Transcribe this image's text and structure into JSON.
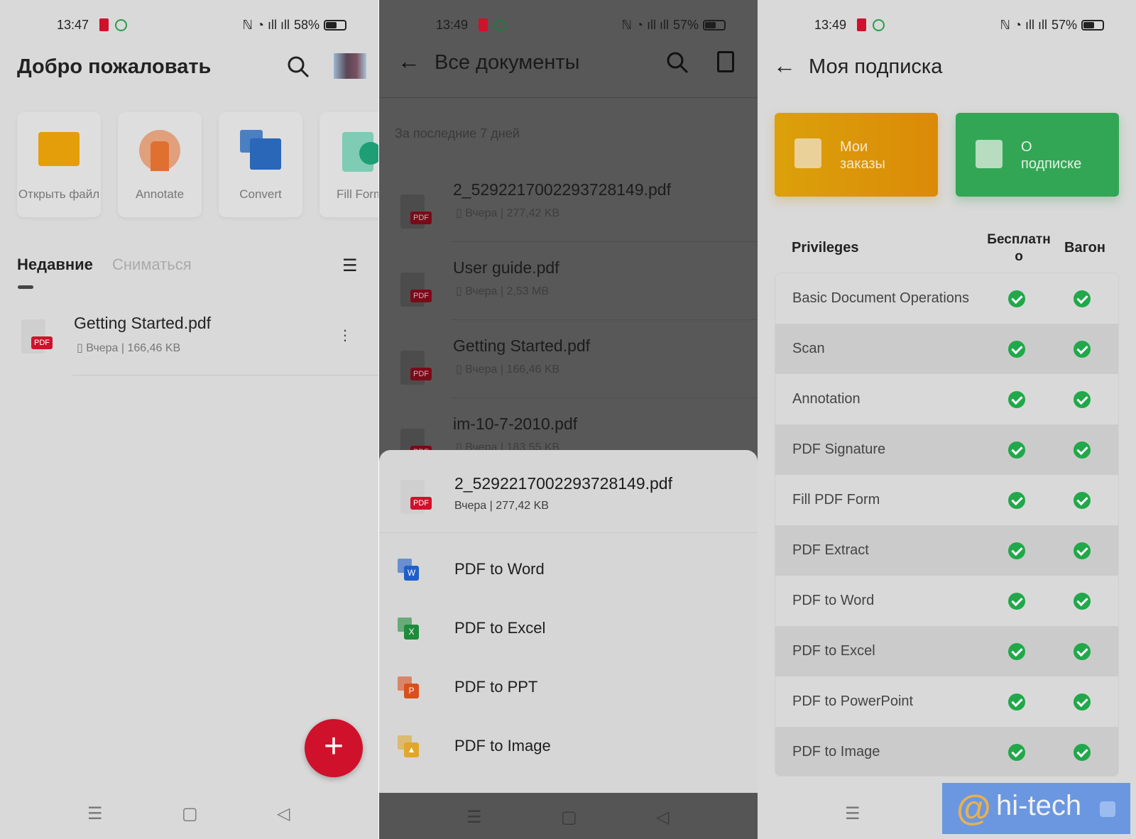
{
  "screen1": {
    "status": {
      "time": "13:47",
      "battery": "58%",
      "battery_level": 58
    },
    "title": "Добро пожаловать",
    "tools": [
      {
        "label": "Открыть файл",
        "icon": "folder-icon"
      },
      {
        "label": "Annotate",
        "icon": "highlighter-icon"
      },
      {
        "label": "Convert",
        "icon": "convert-icon"
      },
      {
        "label": "Fill Form",
        "icon": "clipboard-check-icon"
      }
    ],
    "tabs": [
      {
        "label": "Недавние",
        "active": true
      },
      {
        "label": "Сниматься",
        "active": false
      }
    ],
    "files": [
      {
        "name": "Getting Started.pdf",
        "meta": "Вчера | 166,46 KB",
        "badge": "PDF"
      }
    ],
    "fab": "+"
  },
  "screen2": {
    "status": {
      "time": "13:49",
      "battery": "57%",
      "battery_level": 57
    },
    "title": "Все документы",
    "section": "За последние 7 дней",
    "files": [
      {
        "name": "2_5292217002293728149.pdf",
        "meta": "Вчера | 277,42 KB",
        "badge": "PDF"
      },
      {
        "name": "User guide.pdf",
        "meta": "Вчера | 2,53 MB",
        "badge": "PDF"
      },
      {
        "name": "Getting Started.pdf",
        "meta": "Вчера | 166,46 KB",
        "badge": "PDF"
      },
      {
        "name": "im-10-7-2010.pdf",
        "meta": "Вчера | 183,55 KB",
        "badge": "PDF"
      }
    ],
    "sheet": {
      "file": {
        "name": "2_5292217002293728149.pdf",
        "meta": "Вчера | 277,42 KB",
        "badge": "PDF"
      },
      "actions": [
        {
          "label": "PDF to Word",
          "glyph": "W",
          "color": "#1f5fc9",
          "icon": "word-icon"
        },
        {
          "label": "PDF to Excel",
          "glyph": "X",
          "color": "#1e8c3a",
          "icon": "excel-icon"
        },
        {
          "label": "PDF to PPT",
          "glyph": "P",
          "color": "#d9501e",
          "icon": "ppt-icon"
        },
        {
          "label": "PDF to Image",
          "glyph": "▲",
          "color": "#e0a72a",
          "icon": "image-icon"
        }
      ]
    }
  },
  "screen3": {
    "status": {
      "time": "13:49",
      "battery": "57%",
      "battery_level": 57
    },
    "title": "Моя подписка",
    "cards": [
      {
        "label": "Мои заказы",
        "color": "#e39a08"
      },
      {
        "label": "О подписке",
        "color": "#34a853"
      }
    ],
    "table": {
      "headers": [
        "Privileges",
        "Бесплатно",
        "Вагон"
      ],
      "rows": [
        "Basic Document Operations",
        "Scan",
        "Annotation",
        "PDF Signature",
        "Fill PDF Form",
        "PDF Extract",
        "PDF to Word",
        "PDF to Excel",
        "PDF to PowerPoint",
        "PDF to Image"
      ]
    },
    "watermark": "hi-tech"
  },
  "colors": {
    "accent": "#d0112b",
    "check": "#21a84a"
  }
}
